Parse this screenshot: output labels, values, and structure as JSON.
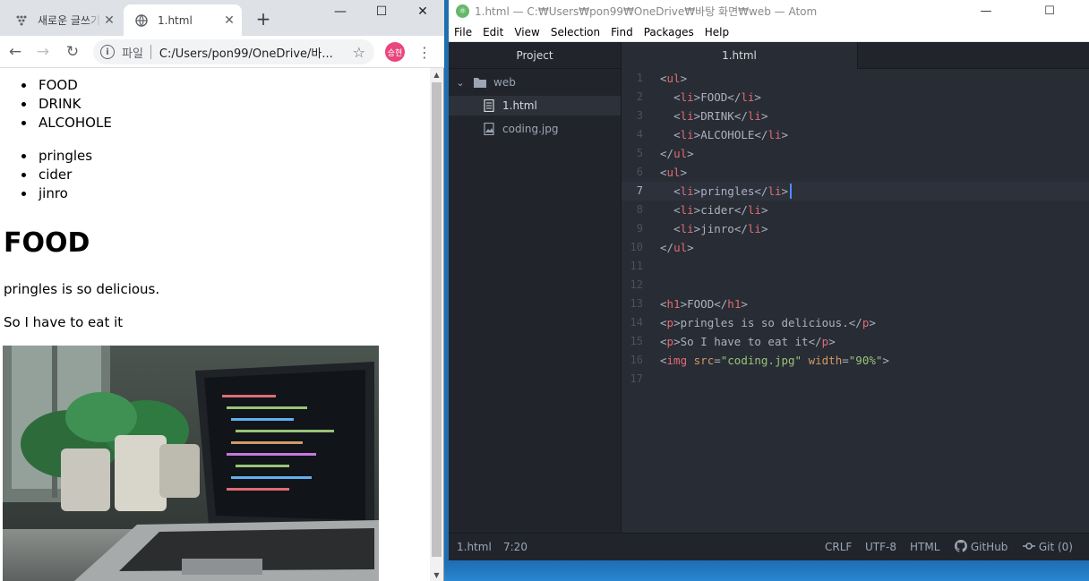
{
  "chrome": {
    "tabs": [
      {
        "title": "새로운 글쓰기",
        "icon": "dots-icon",
        "active": false
      },
      {
        "title": "1.html",
        "icon": "globe-icon",
        "active": true
      }
    ],
    "new_tab_label": "+",
    "window_controls": {
      "minimize": "—",
      "maximize": "☐",
      "close": "✕"
    },
    "nav": {
      "back": "←",
      "forward": "→",
      "reload": "↻"
    },
    "omnibox": {
      "info": "i",
      "scheme": "파일",
      "url": "C:/Users/pon99/OneDrive/바..."
    },
    "star": "☆",
    "avatar_label": "승현",
    "menu": "⋮",
    "page": {
      "list1": [
        "FOOD",
        "DRINK",
        "ALCOHOLE"
      ],
      "list2": [
        "pringles",
        "cider",
        "jinro"
      ],
      "heading": "FOOD",
      "paragraphs": [
        "pringles is so delicious.",
        "So I have to eat it"
      ],
      "scroll_up": "▲",
      "scroll_down": "▼"
    }
  },
  "atom": {
    "title": "1.html — C:₩Users₩pon99₩OneDrive₩바탕 화면₩web — Atom",
    "window_controls": {
      "minimize": "—",
      "maximize": "☐",
      "close": "✕"
    },
    "menu": [
      "File",
      "Edit",
      "View",
      "Selection",
      "Find",
      "Packages",
      "Help"
    ],
    "tree": {
      "header": "Project",
      "root": "web",
      "files": [
        {
          "name": "1.html",
          "icon": "file-text-icon",
          "selected": true
        },
        {
          "name": "coding.jpg",
          "icon": "file-image-icon",
          "selected": false
        }
      ]
    },
    "active_tab": "1.html",
    "code_lines": [
      "<ul>",
      "  <li>FOOD</li>",
      "  <li>DRINK</li>",
      "  <li>ALCOHOLE</li>",
      "</ul>",
      "<ul>",
      "  <li>pringles</li>",
      "  <li>cider</li>",
      "  <li>jinro</li>",
      "</ul>",
      "",
      "",
      "<h1>FOOD</h1>",
      "<p>pringles is so delicious.</p>",
      "<p>So I have to eat it</p>",
      "<img src=\"coding.jpg\" width=\"90%\">",
      ""
    ],
    "cursor_line": 7,
    "status": {
      "file": "1.html",
      "position": "7:20",
      "line_ending": "CRLF",
      "encoding": "UTF-8",
      "grammar": "HTML",
      "github": "GitHub",
      "git": "Git (0)"
    }
  }
}
